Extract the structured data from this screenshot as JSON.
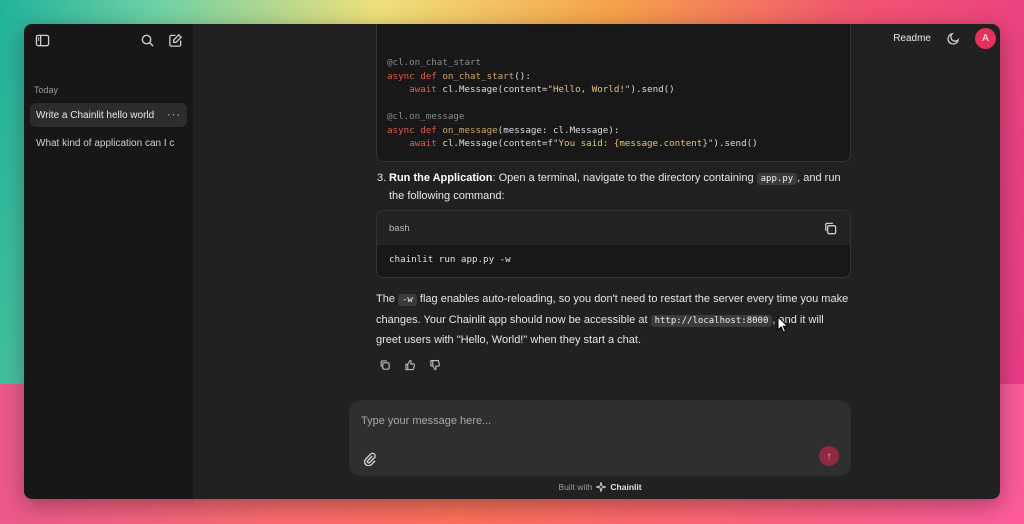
{
  "sidebar": {
    "section_label": "Today",
    "threads": [
      {
        "label": "Write a Chainlit hello world",
        "more": "···"
      },
      {
        "label": "What kind of application can I c"
      }
    ]
  },
  "header": {
    "readme_label": "Readme",
    "avatar_initial": "A",
    "accent_color": "#e8305c"
  },
  "message": {
    "code_top_lines": [
      "@cl.on_chat_start",
      "async def on_chat_start():",
      "    await cl.Message(content=\"Hello, World!\").send()",
      "",
      "@cl.on_message",
      "async def on_message(message: cl.Message):",
      "    await cl.Message(content=f\"You said: {message.content}\").send()"
    ],
    "step3": {
      "number": "3.",
      "title": "Run the Application",
      "text_before": ": Open a terminal, navigate to the directory containing ",
      "code": "app.py",
      "text_after": ", and run the following command:"
    },
    "bash": {
      "language": "bash",
      "command": "chainlit run app.py -w"
    },
    "paragraph": {
      "t1": "The ",
      "code1": "-w",
      "t2": " flag enables auto-reloading, so you don't need to restart the server every time you make changes. Your Chainlit app should now be accessible at ",
      "code2": "http://localhost:8000",
      "t3": ", and it will greet users with \"Hello, World!\" when they start a chat."
    }
  },
  "composer": {
    "placeholder": "Type your message here...",
    "send_icon": "↑"
  },
  "footer": {
    "built_with": "Built with",
    "brand": "Chainlit"
  },
  "icons": [
    "sidebar-toggle-icon",
    "search-icon",
    "new-chat-icon",
    "moon-icon",
    "copy-icon",
    "thumbs-up-icon",
    "thumbs-down-icon",
    "paperclip-icon",
    "arrow-up-icon",
    "chainlit-logo-icon"
  ]
}
